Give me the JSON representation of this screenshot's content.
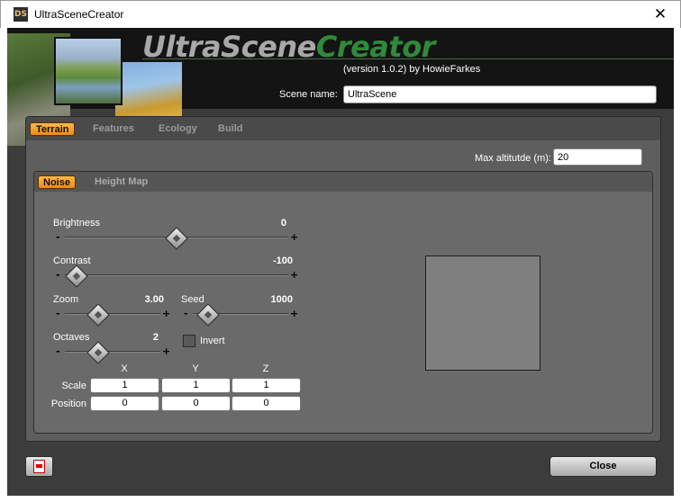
{
  "window": {
    "title": "UltraSceneCreator",
    "app_icon_text": "DS"
  },
  "banner": {
    "logo_part1": "UltraScene",
    "logo_part2": "Creator",
    "version": "(version 1.0.2) by HowieFarkes",
    "scene_name_label": "Scene name:",
    "scene_name_value": "UltraScene"
  },
  "tabs": [
    {
      "label": "Terrain",
      "active": true
    },
    {
      "label": "Features",
      "active": false
    },
    {
      "label": "Ecology",
      "active": false
    },
    {
      "label": "Build",
      "active": false
    }
  ],
  "terrain": {
    "max_altitude_label": "Max altitutde (m):",
    "max_altitude_value": "20"
  },
  "subtabs": [
    {
      "label": "Noise",
      "active": true
    },
    {
      "label": "Height Map",
      "active": false
    }
  ],
  "noise": {
    "sliders": {
      "brightness": {
        "label": "Brightness",
        "value": "0",
        "fraction": 0.5
      },
      "contrast": {
        "label": "Contrast",
        "value": "-100",
        "fraction": 0.0
      },
      "zoom": {
        "label": "Zoom",
        "value": "3.00",
        "fraction": 0.3
      },
      "seed": {
        "label": "Seed",
        "value": "1000",
        "fraction": 0.05
      },
      "octaves": {
        "label": "Octaves",
        "value": "2",
        "fraction": 0.3
      }
    },
    "minus": "-",
    "plus": "+",
    "invert_label": "Invert",
    "invert_checked": false,
    "axes": [
      "X",
      "Y",
      "Z"
    ],
    "scale_label": "Scale",
    "scale": [
      "1",
      "1",
      "1"
    ],
    "position_label": "Position",
    "position": [
      "0",
      "0",
      "0"
    ]
  },
  "footer": {
    "close_label": "Close"
  },
  "colors": {
    "accent_tab": "#f08a10",
    "logo_green": "#2f8a3a",
    "panel_bg": "#5e5e5e"
  }
}
